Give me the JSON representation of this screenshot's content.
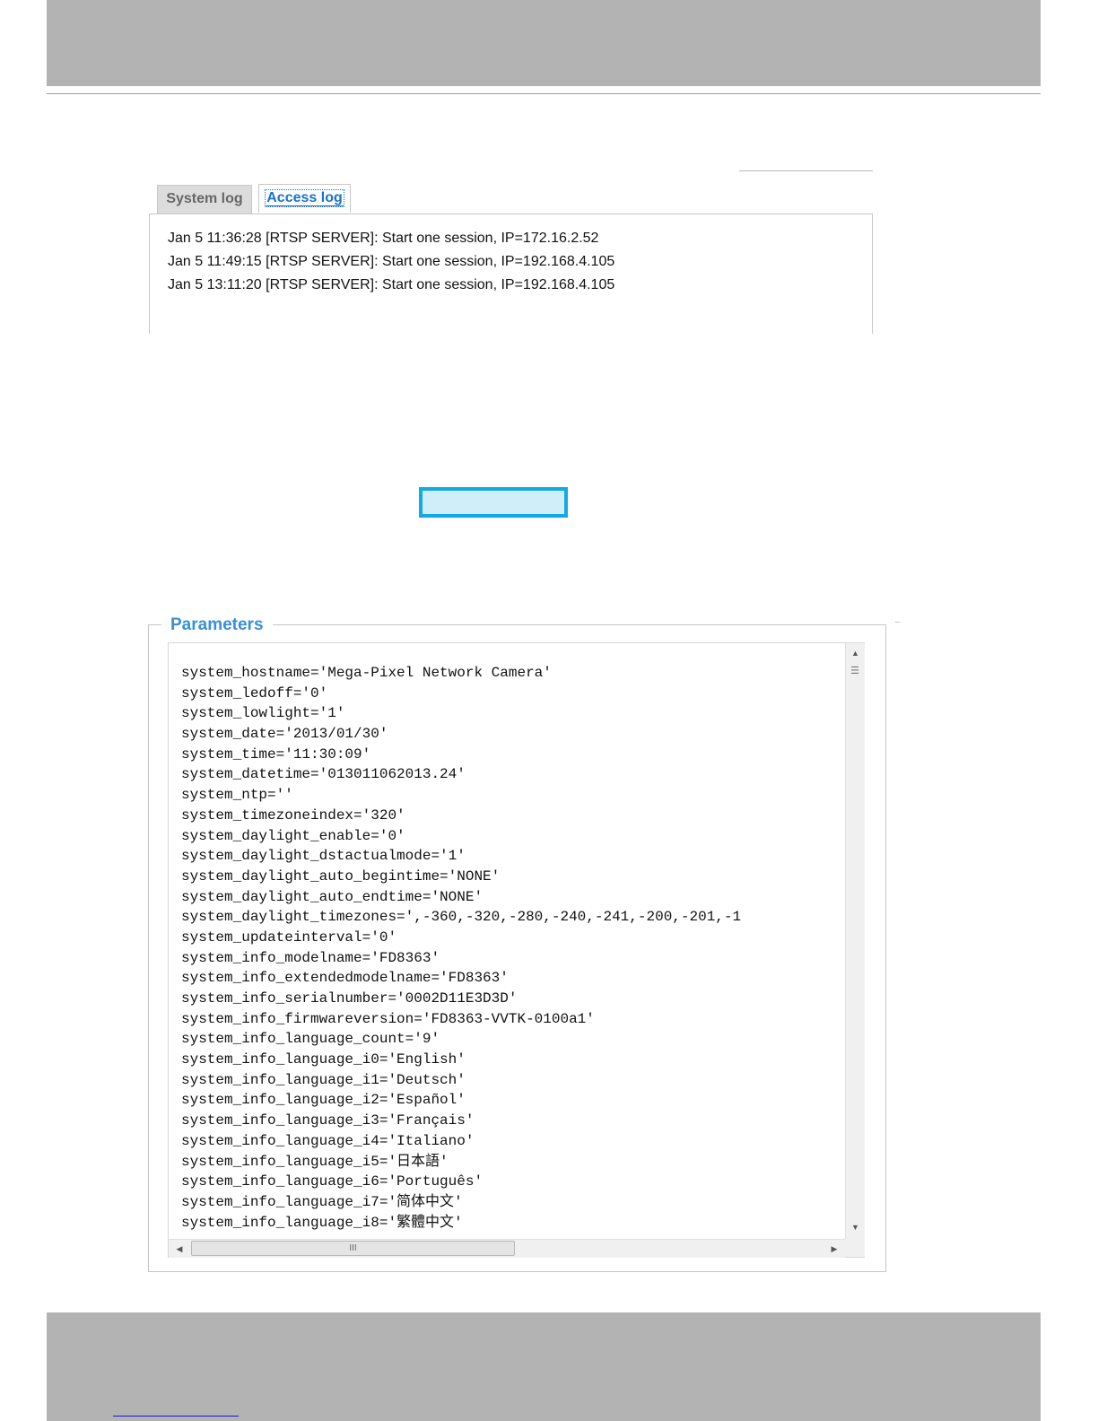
{
  "log_viewer": {
    "tabs": [
      {
        "label": "System log",
        "active": false
      },
      {
        "label": "Access log",
        "active": true
      }
    ],
    "entries": [
      "Jan 5 11:36:28 [RTSP SERVER]: Start one session, IP=172.16.2.52",
      "Jan 5 11:49:15 [RTSP SERVER]: Start one session, IP=192.168.4.105",
      "Jan 5 13:11:20 [RTSP SERVER]: Start one session, IP=192.168.4.105"
    ]
  },
  "parameters": {
    "legend": "Parameters",
    "lines": [
      "system_hostname='Mega-Pixel Network Camera'",
      "system_ledoff='0'",
      "system_lowlight='1'",
      "system_date='2013/01/30'",
      "system_time='11:30:09'",
      "system_datetime='013011062013.24'",
      "system_ntp=''",
      "system_timezoneindex='320'",
      "system_daylight_enable='0'",
      "system_daylight_dstactualmode='1'",
      "system_daylight_auto_begintime='NONE'",
      "system_daylight_auto_endtime='NONE'",
      "system_daylight_timezones=',-360,-320,-280,-240,-241,-200,-201,-1",
      "system_updateinterval='0'",
      "system_info_modelname='FD8363'",
      "system_info_extendedmodelname='FD8363'",
      "system_info_serialnumber='0002D11E3D3D'",
      "system_info_firmwareversion='FD8363-VVTK-0100a1'",
      "system_info_language_count='9'",
      "system_info_language_i0='English'",
      "system_info_language_i1='Deutsch'",
      "system_info_language_i2='Español'",
      "system_info_language_i3='Français'",
      "system_info_language_i4='Italiano'",
      "system_info_language_i5='日本語'",
      "system_info_language_i6='Português'",
      "system_info_language_i7='简体中文'",
      "system_info_language_i8='繁體中文'"
    ],
    "scrollbar": {
      "up_arrow": "▲",
      "down_arrow": "▼",
      "left_arrow": "◀",
      "right_arrow": "▶",
      "thumb_grip": "III"
    }
  },
  "colors": {
    "band": "#b3b3b3",
    "accent": "#1a73c9",
    "highlight_border": "#13a9e6",
    "highlight_fill": "#cfeefa"
  }
}
